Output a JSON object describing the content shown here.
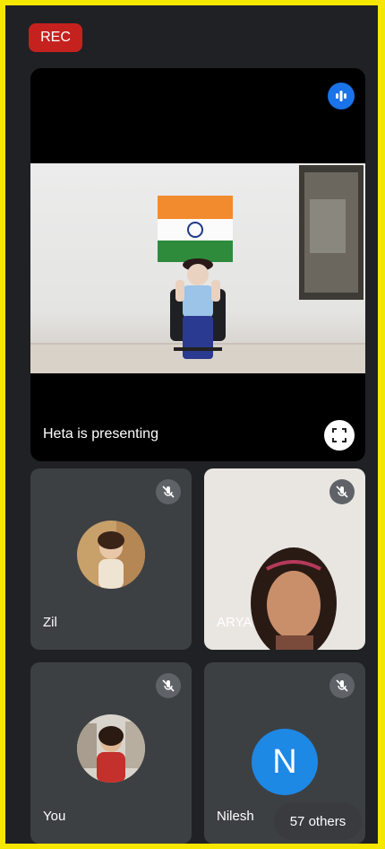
{
  "rec_label": "REC",
  "presenter": {
    "label": "Heta is presenting",
    "audio_icon": "audio-level-icon",
    "fullscreen_icon": "fullscreen-icon"
  },
  "participants": [
    {
      "name": "Zil",
      "muted": true
    },
    {
      "name": "ARYA",
      "muted": true
    },
    {
      "name": "You",
      "muted": true
    },
    {
      "name": "Nilesh",
      "muted": true,
      "initial": "N"
    }
  ],
  "others_label": "57 others",
  "colors": {
    "background": "#202124",
    "tile": "#3c4043",
    "rec": "#c5221f",
    "accent": "#1a73e8",
    "avatar_blue": "#1e88e5",
    "border": "#ffe600"
  }
}
